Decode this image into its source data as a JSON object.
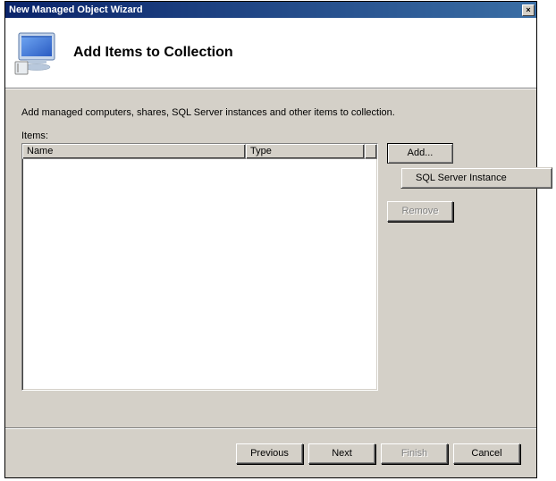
{
  "titlebar": {
    "text": "New Managed Object Wizard",
    "close_glyph": "✕"
  },
  "header": {
    "page_title": "Add Items to Collection"
  },
  "content": {
    "instruction": "Add managed computers, shares, SQL Server instances and other items to collection.",
    "items_label": "Items:",
    "columns": {
      "name": "Name",
      "type": "Type"
    }
  },
  "side_buttons": {
    "add": "Add...",
    "remove": "Remove"
  },
  "dropdown": {
    "items": [
      "SQL Server Instance"
    ]
  },
  "wizard": {
    "previous": "Previous",
    "next": "Next",
    "finish": "Finish",
    "cancel": "Cancel"
  }
}
